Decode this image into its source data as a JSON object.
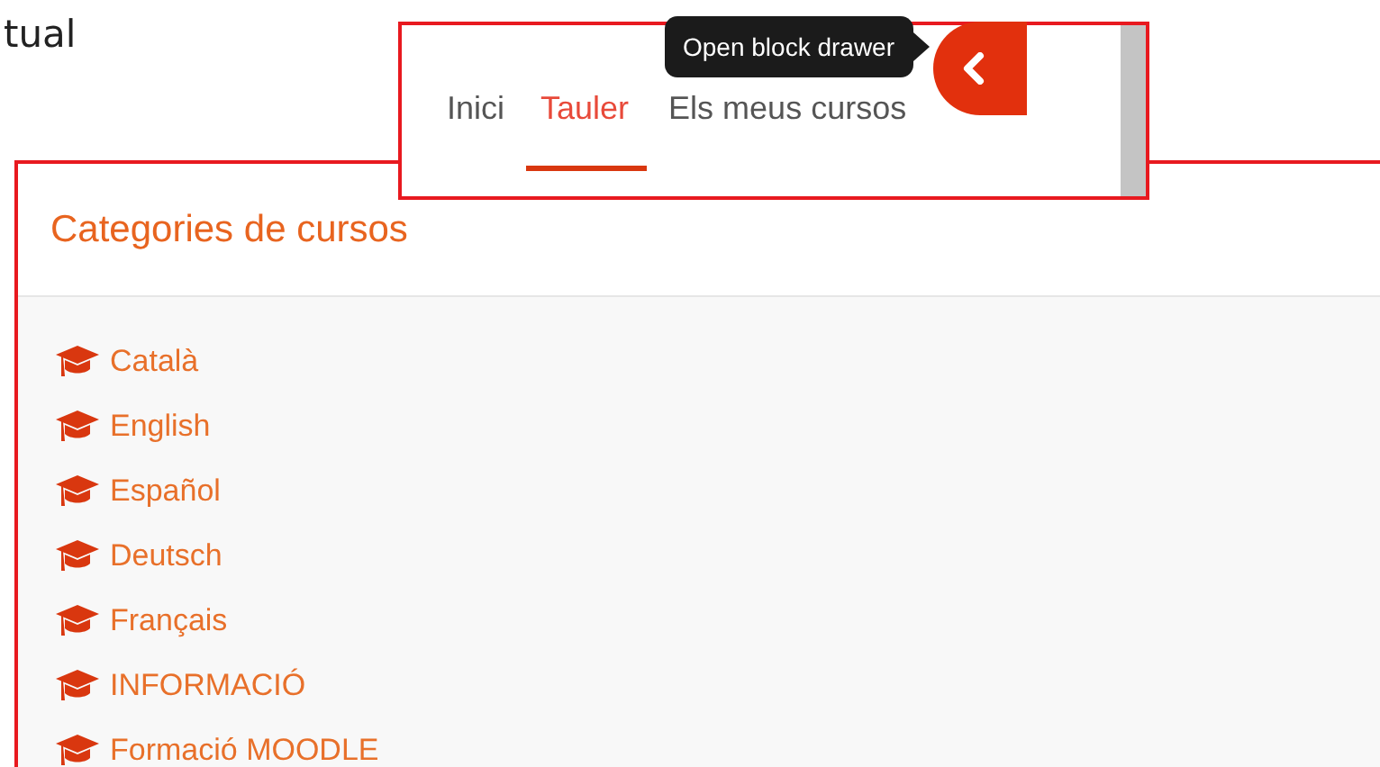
{
  "page_fragment": "tual",
  "nav": {
    "items": [
      {
        "label": "Inici",
        "selected": false
      },
      {
        "label": "Tauler",
        "selected": true
      },
      {
        "label": "Els meus cursos",
        "selected": false
      }
    ],
    "tooltip": "Open block drawer"
  },
  "block": {
    "title": "Categories de cursos",
    "categories": [
      "Català",
      "English",
      "Español",
      "Deutsch",
      "Français",
      "INFORMACIÓ",
      "Formació MOODLE"
    ]
  }
}
